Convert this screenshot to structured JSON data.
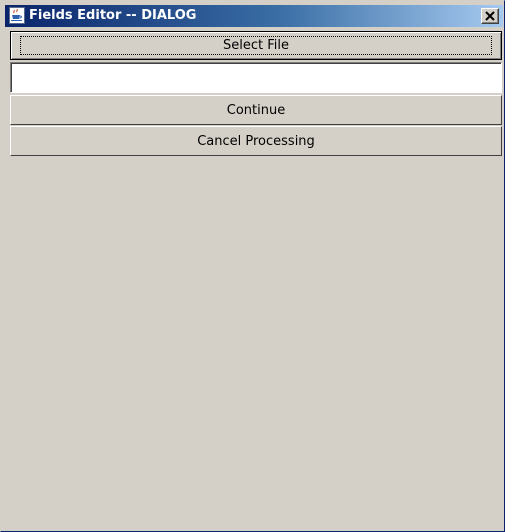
{
  "window": {
    "title": "Fields Editor -- DIALOG",
    "app_icon": "java-coffee-cup-icon",
    "close_icon": "close-icon"
  },
  "dialog": {
    "select_file_label": "Select File",
    "file_path_value": "",
    "file_path_placeholder": "",
    "continue_label": "Continue",
    "cancel_label": "Cancel Processing"
  }
}
